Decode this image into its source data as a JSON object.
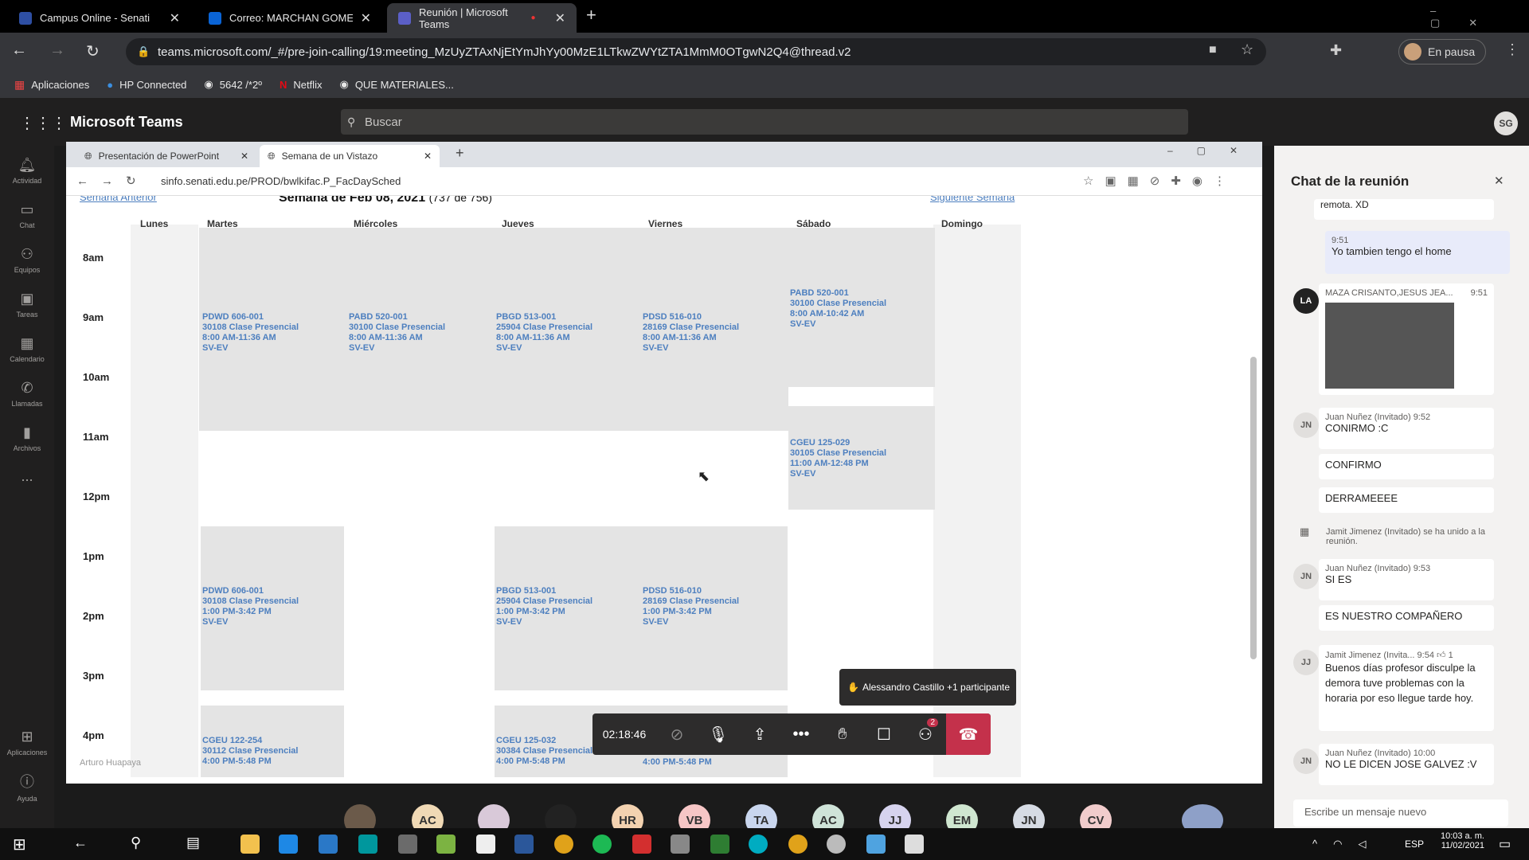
{
  "browser": {
    "tabs": [
      {
        "title": "Campus Online - Senati"
      },
      {
        "title": "Correo: MARCHAN GOMEZ,SE"
      },
      {
        "title": "Reunión | Microsoft Teams"
      }
    ],
    "url": "teams.microsoft.com/_#/pre-join-calling/19:meeting_MzUyZTAxNjEtYmJhYy00MzE1LTkwZWYtZTA1MmM0OTgwN2Q4@thread.v2",
    "profile_label": "En pausa",
    "bookmarks": [
      "Aplicaciones",
      "HP Connected",
      "5642 /*2º",
      "Netflix",
      "QUE MATERIALES..."
    ]
  },
  "teams": {
    "app_name": "Microsoft Teams",
    "search_placeholder": "Buscar",
    "user_initials": "SG",
    "rail": [
      "Actividad",
      "Chat",
      "Equipos",
      "Tareas",
      "Calendario",
      "Llamadas",
      "Archivos",
      "...",
      "Aplicaciones",
      "Ayuda"
    ]
  },
  "shared": {
    "tabs": [
      "Presentación de PowerPoint",
      "Semana de un Vistazo"
    ],
    "url": "sinfo.senati.edu.pe/PROD/bwlkifac.P_FacDaySched",
    "prev_week": "Semana Anterior",
    "next_week": "Siguiente Semana",
    "title": "Semana de Feb 08, 2021",
    "count": "(737 de 756)",
    "days": [
      "Lunes",
      "Martes",
      "Miércoles",
      "Jueves",
      "Viernes",
      "Sábado",
      "Domingo"
    ],
    "hours": [
      "8am",
      "9am",
      "10am",
      "11am",
      "12pm",
      "1pm",
      "2pm",
      "3pm",
      "4pm"
    ],
    "classes": [
      "PDWD 606-001\n30108 Clase Presencial\n8:00 AM-11:36 AM\nSV-EV",
      "PABD 520-001\n30100 Clase Presencial\n8:00 AM-11:36 AM\nSV-EV",
      "PBGD 513-001\n25904 Clase Presencial\n8:00 AM-11:36 AM\nSV-EV",
      "PDSD 516-010\n28169 Clase Presencial\n8:00 AM-11:36 AM\nSV-EV",
      "PABD 520-001\n30100 Clase Presencial\n8:00 AM-10:42 AM\nSV-EV",
      "CGEU 125-029\n30105 Clase Presencial\n11:00 AM-12:48 PM\nSV-EV",
      "PDWD 606-001\n30108 Clase Presencial\n1:00 PM-3:42 PM\nSV-EV",
      "PBGD 513-001\n25904 Clase Presencial\n1:00 PM-3:42 PM\nSV-EV",
      "PDSD 516-010\n28169 Clase Presencial\n1:00 PM-3:42 PM\nSV-EV",
      "CGEU 122-254\n30112 Clase Presencial\n4:00 PM-5:48 PM",
      "CGEU 125-032\n30384 Clase Presencial\n4:00 PM-5:48 PM",
      "4:00 PM-5:48 PM"
    ],
    "presenter": "Arturo Huapaya"
  },
  "meeting": {
    "timer": "02:18:46",
    "raise_notice": "Alessandro Castillo +1 participante",
    "participants_badge": "2"
  },
  "chat": {
    "title": "Chat de la reunión",
    "top_fragment": "remota. XD",
    "messages": [
      {
        "time": "9:51",
        "text": "Yo tambien tengo el home"
      },
      {
        "author": "MAZA CRISANTO,JESUS JEA...",
        "time": "9:51"
      },
      {
        "author": "Juan Nuñez (Invitado)",
        "time": "9:52",
        "text": "CONIRMO :C",
        "initials": "JN"
      },
      {
        "text": "CONFIRMO"
      },
      {
        "text": "DERRAMEEEE"
      },
      {
        "text": "Jamit Jimenez (Invitado) se ha unido a la reunión."
      },
      {
        "author": "Juan Nuñez (Invitado)",
        "time": "9:53",
        "text": "SI ES",
        "initials": "JN"
      },
      {
        "text": "ES NUESTRO COMPAÑERO"
      },
      {
        "author": "Jamit Jimenez (Invita...",
        "time": "9:54",
        "reaction": "1",
        "text": "Buenos días profesor disculpe la demora tuve problemas con la horaria por eso llegue tarde hoy.",
        "initials": "JJ"
      },
      {
        "author": "Juan Nuñez (Invitado)",
        "time": "10:00",
        "text": "NO LE DICEN JOSE GALVEZ :V",
        "initials": "JN"
      }
    ],
    "compose_placeholder": "Escribe un mensaje nuevo"
  },
  "participants": [
    "AC",
    "HR",
    "VB",
    "TA",
    "AC",
    "JJ",
    "EM",
    "JN",
    "CV"
  ],
  "taskbar": {
    "lang": "ESP",
    "time": "10:03 a. m.",
    "date": "11/02/2021"
  }
}
